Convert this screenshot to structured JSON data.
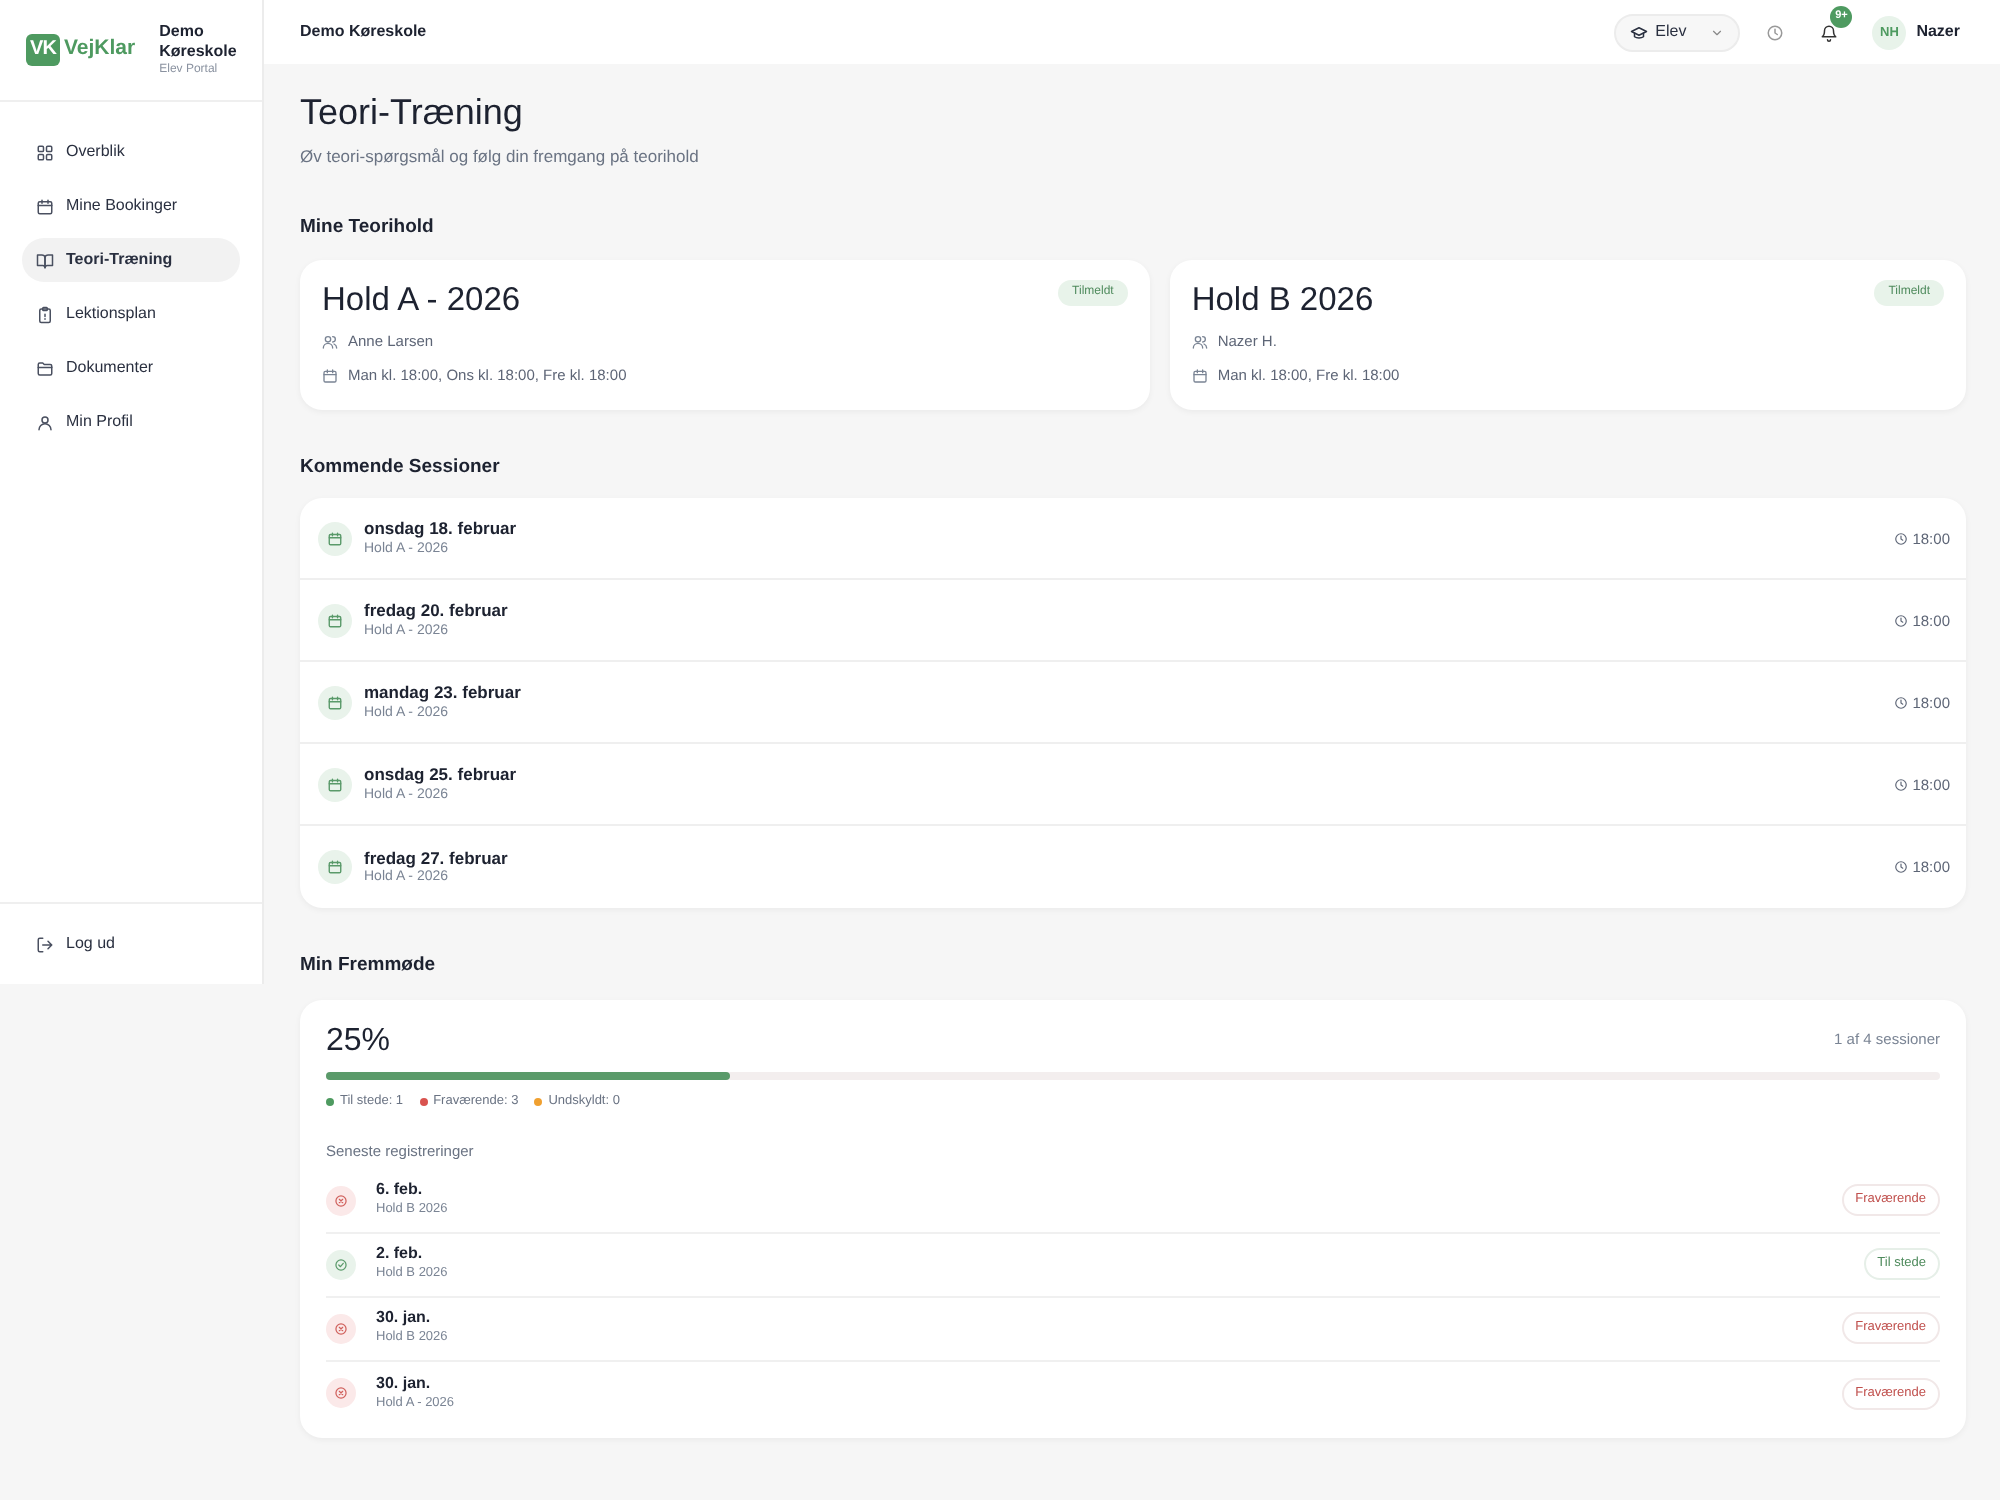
{
  "sidebar": {
    "logo": {
      "mark": "VK",
      "name": "VejKlar"
    },
    "school": "Demo Køreskole",
    "portal": "Elev Portal",
    "items": [
      {
        "label": "Overblik",
        "selected": false
      },
      {
        "label": "Mine Bookinger",
        "selected": false
      },
      {
        "label": "Teori-Træning",
        "selected": true
      },
      {
        "label": "Lektionsplan",
        "selected": false
      },
      {
        "label": "Dokumenter",
        "selected": false
      },
      {
        "label": "Min Profil",
        "selected": false
      }
    ],
    "logout": "Log ud"
  },
  "topbar": {
    "school": "Demo Køreskole",
    "role": "Elev",
    "notifications": "9+",
    "avatar": "NH",
    "user": "Nazer"
  },
  "page": {
    "title": "Teori-Træning",
    "subtitle": "Øv teori-spørgsmål og følg din fremgang på teorihold"
  },
  "teams": {
    "heading": "Mine Teorihold",
    "items": [
      {
        "name": "Hold A - 2026",
        "status": "Tilmeldt",
        "teacher": "Anne Larsen",
        "schedule": "Man kl. 18:00, Ons kl. 18:00, Fre kl. 18:00"
      },
      {
        "name": "Hold B 2026",
        "status": "Tilmeldt",
        "teacher": "Nazer H.",
        "schedule": "Man kl. 18:00, Fre kl. 18:00"
      }
    ]
  },
  "sessions": {
    "heading": "Kommende Sessioner",
    "items": [
      {
        "date": "onsdag 18. februar",
        "team": "Hold A - 2026",
        "time": "18:00"
      },
      {
        "date": "fredag 20. februar",
        "team": "Hold A - 2026",
        "time": "18:00"
      },
      {
        "date": "mandag 23. februar",
        "team": "Hold A - 2026",
        "time": "18:00"
      },
      {
        "date": "onsdag 25. februar",
        "team": "Hold A - 2026",
        "time": "18:00"
      },
      {
        "date": "fredag 27. februar",
        "team": "Hold A - 2026",
        "time": "18:00"
      }
    ]
  },
  "attendance": {
    "heading": "Min Fremmøde",
    "percent": "25%",
    "level": 0.25,
    "summary": "1 af 4 sessioner",
    "legend": [
      {
        "label": "Til stede: 1",
        "color": "#4e9a60"
      },
      {
        "label": "Fraværende: 3",
        "color": "#d9534f"
      },
      {
        "label": "Undskyldt: 0",
        "color": "#f0a030"
      }
    ],
    "recent_heading": "Seneste registreringer",
    "records": [
      {
        "date": "6. feb.",
        "team": "Hold B 2026",
        "status": "Fraværende",
        "kind": "absent"
      },
      {
        "date": "2. feb.",
        "team": "Hold B 2026",
        "status": "Til stede",
        "kind": "present"
      },
      {
        "date": "30. jan.",
        "team": "Hold B 2026",
        "status": "Fraværende",
        "kind": "absent"
      },
      {
        "date": "30. jan.",
        "team": "Hold A - 2026",
        "status": "Fraværende",
        "kind": "absent"
      }
    ]
  }
}
